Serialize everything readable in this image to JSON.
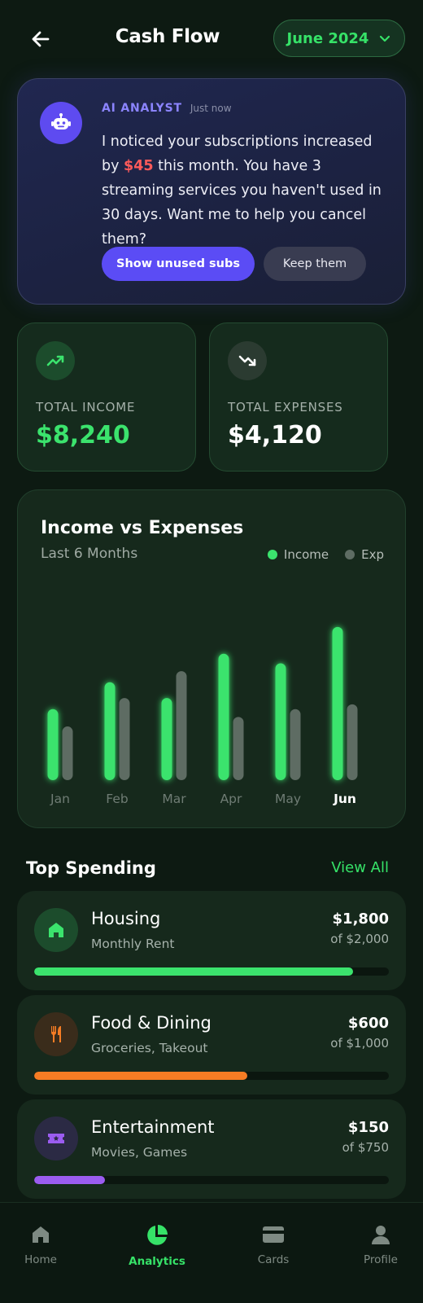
{
  "header": {
    "title": "Cash Flow",
    "month": "June 2024"
  },
  "ai_card": {
    "name": "AI ANALYST",
    "time": "Just now",
    "message_part1": "I noticed your subscriptions increased by ",
    "message_amount": "$45",
    "message_part2": " this month. You have 3 streaming services you haven't used in 30 days. Want me to help you cancel them?",
    "primary_button": "Show unused subs",
    "secondary_button": "Keep them"
  },
  "stats": {
    "income_label": "TOTAL INCOME",
    "income_value": "$8,240",
    "expenses_label": "TOTAL EXPENSES",
    "expenses_value": "$4,120"
  },
  "chart": {
    "title": "Income vs Expenses",
    "subtitle": "Last 6 Months",
    "legend_income": "Income",
    "legend_expenses": "Exp"
  },
  "chart_data": {
    "type": "bar",
    "categories": [
      "Jan",
      "Feb",
      "Mar",
      "Apr",
      "May",
      "Jun"
    ],
    "series": [
      {
        "name": "Income",
        "values": [
          45,
          62,
          52,
          80,
          74,
          97
        ],
        "color": "#3be36d"
      },
      {
        "name": "Exp",
        "values": [
          34,
          52,
          69,
          40,
          45,
          48
        ],
        "color": "#5e6c63"
      }
    ],
    "ylim": [
      0,
      100
    ],
    "highlight_category": "Jun"
  },
  "top_spending": {
    "title": "Top Spending",
    "view_all": "View All",
    "items": [
      {
        "name": "Housing",
        "desc": "Monthly Rent",
        "amount": "$1,800",
        "of": "of $2,000",
        "progress": 0.9,
        "color": "#3be36d",
        "icon_bg": "#1c4c2c",
        "icon": "home-icon"
      },
      {
        "name": "Food & Dining",
        "desc": "Groceries, Takeout",
        "amount": "$600",
        "of": "of $1,000",
        "progress": 0.6,
        "color": "#f57c24",
        "icon_bg": "#3a2c1b",
        "icon": "utensils-icon"
      },
      {
        "name": "Entertainment",
        "desc": "Movies, Games",
        "amount": "$150",
        "of": "of $750",
        "progress": 0.2,
        "color": "#9b5cf0",
        "icon_bg": "#2b2a44",
        "icon": "ticket-icon"
      }
    ]
  },
  "nav": {
    "items": [
      {
        "label": "Home",
        "icon": "home-icon"
      },
      {
        "label": "Analytics",
        "icon": "pie-chart-icon",
        "active": true
      },
      {
        "label": "Cards",
        "icon": "card-icon"
      },
      {
        "label": "Profile",
        "icon": "user-icon"
      }
    ]
  }
}
